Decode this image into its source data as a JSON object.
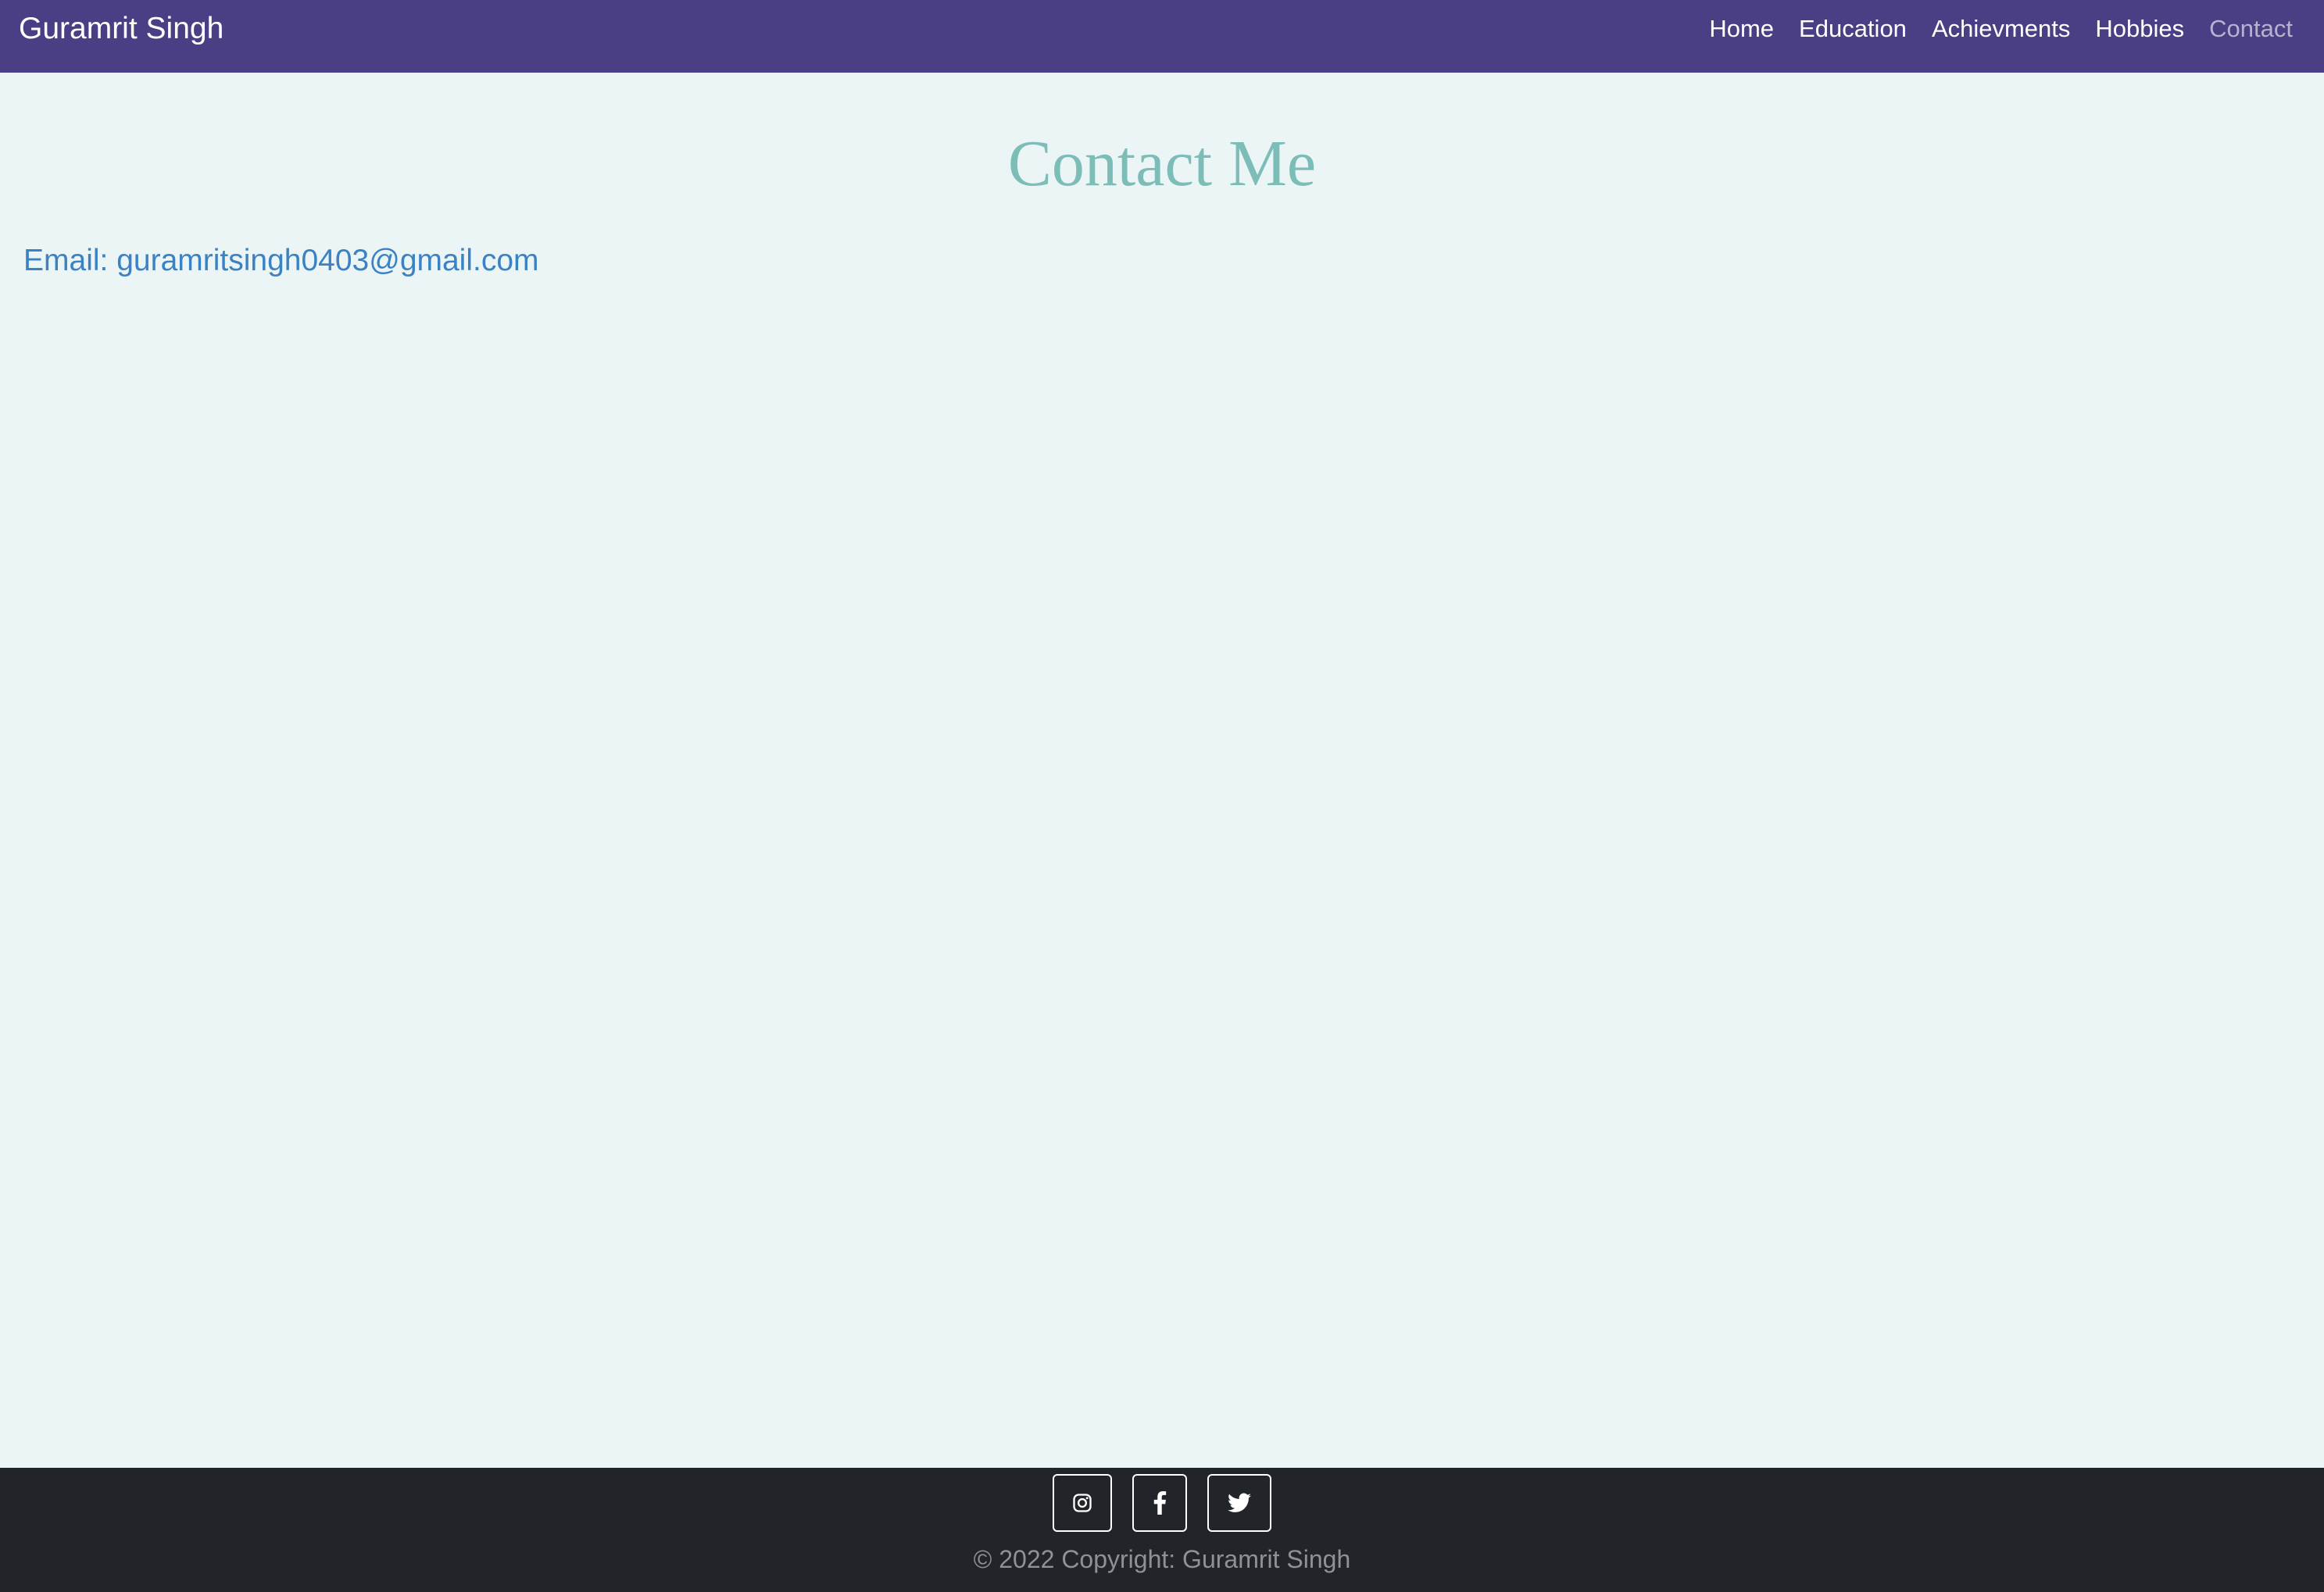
{
  "navbar": {
    "brand": "Guramrit Singh",
    "links": [
      {
        "label": "Home",
        "active": false
      },
      {
        "label": "Education",
        "active": false
      },
      {
        "label": "Achievments",
        "active": false
      },
      {
        "label": "Hobbies",
        "active": false
      },
      {
        "label": "Contact",
        "active": true
      }
    ]
  },
  "main": {
    "title": "Contact Me",
    "email_prefix": "Email: ",
    "email_address": "guramritsingh0403@gmail.com"
  },
  "footer": {
    "social": [
      {
        "icon": "instagram-icon"
      },
      {
        "icon": "facebook-icon"
      },
      {
        "icon": "twitter-icon"
      }
    ],
    "copyright": "© 2022 Copyright: Guramrit Singh"
  },
  "colors": {
    "navbar_bg": "#4a3f85",
    "page_bg": "#ebf5f5",
    "title": "#7dbdb8",
    "email": "#3b82c4",
    "footer_bg": "#212429",
    "nav_active": "#b6b2cf"
  }
}
